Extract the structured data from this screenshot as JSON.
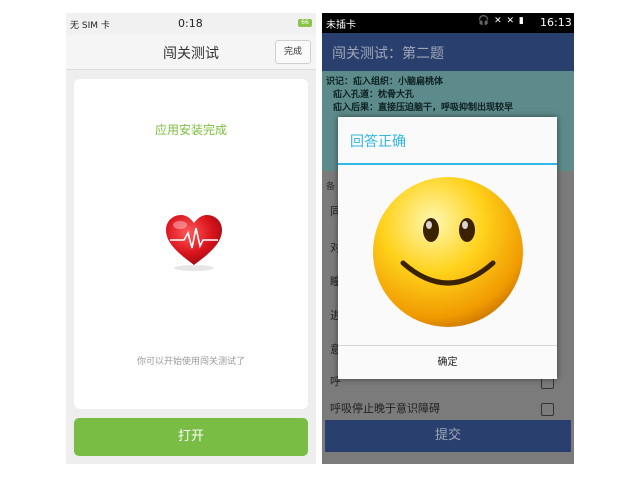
{
  "left": {
    "status": {
      "carrier": "无 SIM 卡",
      "time": "0:18",
      "battery": "66"
    },
    "title": "闯关测试",
    "done_label": "完成",
    "installed_text": "应用安装完成",
    "hint_text": "你可以开始使用闯关测试了",
    "open_label": "打开",
    "accent_color": "#79bd45"
  },
  "right": {
    "status": {
      "carrier": "未插卡",
      "time": "16:13"
    },
    "app_title": "闯关测试：第二题",
    "info_lines": [
      "识记：疝入组织：小脑扁桃体",
      "疝入孔道：枕骨大孔",
      "疝入后果：直接压迫脑干，呼吸抑制出现较早"
    ],
    "practice_label": "练",
    "options_hint": "备",
    "options": [
      {
        "label": "同"
      },
      {
        "label": "对"
      },
      {
        "label": "瞳"
      },
      {
        "label": "进"
      },
      {
        "label": "意"
      },
      {
        "label": "呼"
      },
      {
        "label": "呼吸停止晚于意识障碍"
      }
    ],
    "submit_label": "提交",
    "dialog": {
      "title": "回答正确",
      "ok_label": "确定",
      "accent_color": "#33b5e5"
    }
  }
}
